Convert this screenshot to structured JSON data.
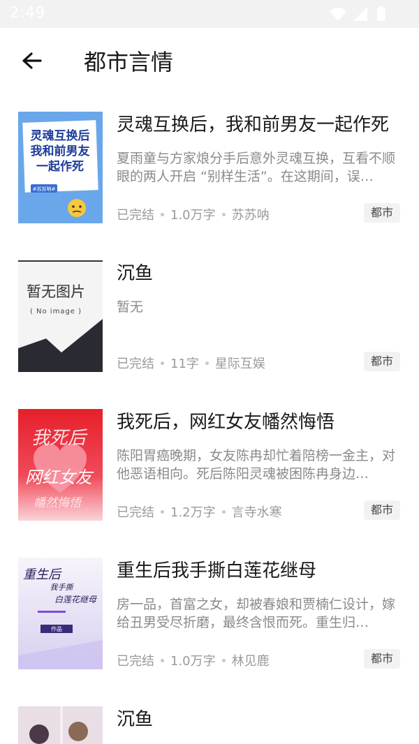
{
  "status_bar": {
    "time": "2:49",
    "icons": [
      "wifi-icon",
      "signal-icon",
      "battery-icon"
    ]
  },
  "header": {
    "title": "都市言情",
    "back_icon": "arrow-left-icon"
  },
  "books": [
    {
      "title": "灵魂互换后，我和前男友一起作死",
      "description": "夏雨童与方家烺分手后意外灵魂互换，互看不顺眼的两人开启 “别样生活”。在这期间，误…",
      "status": "已完结",
      "words": "1.0万字",
      "author": "苏苏呐",
      "tag": "都市",
      "cover_text": [
        "灵魂互换后",
        "我和前男友",
        "一起作死"
      ],
      "cover_badge": "#苏苏呐#"
    },
    {
      "title": "沉鱼",
      "description": "暂无",
      "status": "已完结",
      "words": "11字",
      "author": "星际互娱",
      "tag": "都市",
      "cover_text": [
        "暂无图片",
        "( No image )"
      ]
    },
    {
      "title": "我死后，网红女友幡然悔悟",
      "description": "陈阳胃癌晚期，女友陈冉却忙着陪榜一金主，对他恶语相向。死后陈阳灵魂被困陈冉身边…",
      "status": "已完结",
      "words": "1.2万字",
      "author": "言寺水寒",
      "tag": "都市",
      "cover_text": [
        "我死后",
        "网红女友",
        "幡然悔悟"
      ]
    },
    {
      "title": "重生后我手撕白莲花继母",
      "description": "房一品，首富之女，却被春娘和贾楠仁设计，嫁给丑男受尽折磨，最终含恨而死。重生归…",
      "status": "已完结",
      "words": "1.0万字",
      "author": "林见鹿",
      "tag": "都市",
      "cover_text": [
        "重生后",
        "我手撕",
        "白莲花继母",
        "作品"
      ]
    },
    {
      "title": "沉鱼"
    }
  ]
}
